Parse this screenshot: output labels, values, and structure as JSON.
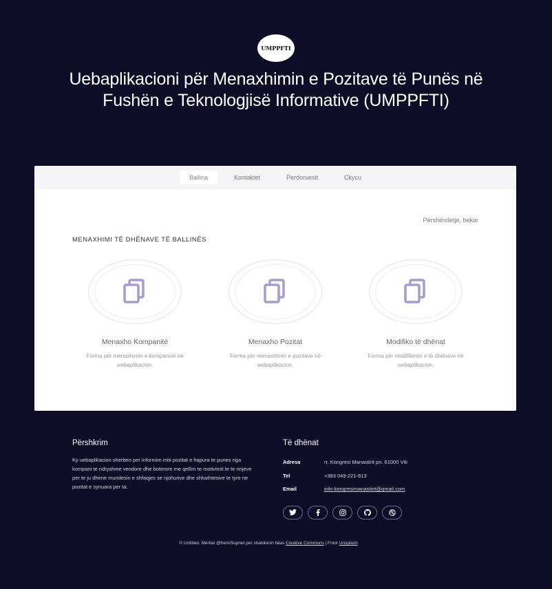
{
  "header": {
    "logo_text": "UMPPFTI",
    "title": "Uebaplikacioni për Menaxhimin e Pozitave të Punës në Fushën e Teknologjisë Informative (UMPPFTI)"
  },
  "nav": {
    "items": [
      {
        "label": "Ballina",
        "active": true
      },
      {
        "label": "Kontaktet",
        "active": false
      },
      {
        "label": "Perdoruesit",
        "active": false
      },
      {
        "label": "Ckycu",
        "active": false
      }
    ]
  },
  "main": {
    "greeting": "Përshëndetje, bekar",
    "section_heading": "MENAXHIMI TË DHËNAVE TË BALLINËS",
    "features": [
      {
        "title": "Menaxho Kompanitë",
        "description": "Forma për menaxhimin e kompanive në webaplikacion.",
        "icon": "copy-icon"
      },
      {
        "title": "Menaxho Pozitat",
        "description": "Forma për menaxhimin e pozitave në webaplikacion.",
        "icon": "copy-icon"
      },
      {
        "title": "Modifiko të dhënat",
        "description": "Forma për modifikimin e të dhënave në webaplikacion.",
        "icon": "copy-icon"
      }
    ],
    "icon_color": "#a79bcf"
  },
  "footer": {
    "about": {
      "heading": "Përshkrim",
      "text": "Ky uebaplikacion sherben per informim mbi pozitat e hapura te punes nga kompani te ndryshme vendore dhe boterore me qellim te motivimit te te rinjeve per te ju dhene mundesin e shfaqjes se njohurive dhe shkathtesive te tyre ne pozitat e synuara per ta."
    },
    "info": {
      "heading": "Të dhënat",
      "address_label": "Adresa",
      "address": "rr. Kongresi Manastirit pn. 61000 Viti",
      "phone_label": "Tel",
      "phone": "+383 049-221-813",
      "email_label": "Email",
      "email": "info-kongresimanastirit@gmail.com"
    },
    "socials": [
      "twitter-icon",
      "facebook-icon",
      "instagram-icon",
      "github-icon",
      "dribbble-icon"
    ],
    "copyright": {
      "prefix": "© Untitled. Meritat @hemiSupnet per shabllonin falas",
      "license": "Creative Commons",
      "separator": " | Fotot ",
      "photos": "Unsplash"
    }
  },
  "colors": {
    "background": "#0e0c27",
    "panel": "#ffffff",
    "nav_bg": "#f5f5f7",
    "accent_icon": "#a79bcf"
  }
}
